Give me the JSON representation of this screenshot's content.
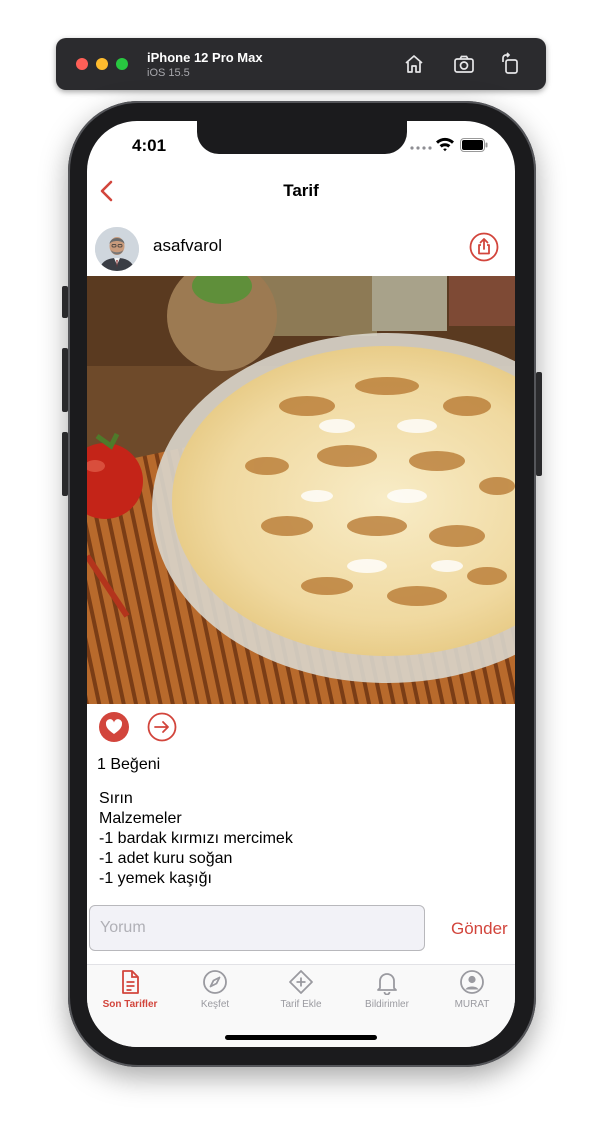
{
  "simulator": {
    "device_name": "iPhone 12 Pro Max",
    "os_version": "iOS 15.5"
  },
  "status_bar": {
    "time": "4:01"
  },
  "nav": {
    "title": "Tarif"
  },
  "post": {
    "username": "asafvarol",
    "likes_text": "1 Beğeni",
    "description_lines": [
      "Sırın",
      "",
      "Malzemeler",
      "-1 bardak kırmızı mercimek",
      "-1 adet kuru soğan",
      "-1 yemek kaşığı"
    ]
  },
  "comment": {
    "placeholder": "Yorum",
    "value": "",
    "send_label": "Gönder"
  },
  "tabbar": {
    "items": [
      {
        "label": "Son Tarifler",
        "icon": "document-icon",
        "active": true
      },
      {
        "label": "Keşfet",
        "icon": "compass-icon",
        "active": false
      },
      {
        "label": "Tarif Ekle",
        "icon": "add-diamond-icon",
        "active": false
      },
      {
        "label": "Bildirimler",
        "icon": "bell-icon",
        "active": false
      },
      {
        "label": "MURAT",
        "icon": "profile-icon",
        "active": false
      }
    ]
  },
  "colors": {
    "accent": "#d2453c",
    "inactive": "#9a9aa0"
  }
}
